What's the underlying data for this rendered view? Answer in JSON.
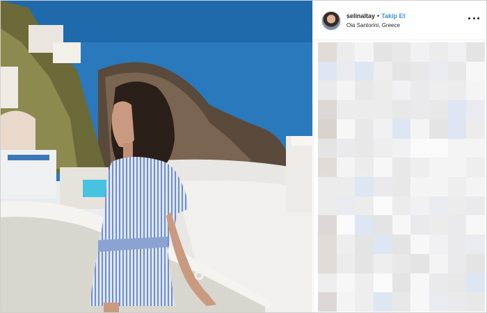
{
  "post": {
    "username": "selinaltay",
    "separator": "•",
    "follow_label": "Takip Et",
    "location": "Oia Santorini, Greece"
  },
  "icons": {
    "more": "more-options-icon",
    "avatar": "avatar"
  },
  "colors": {
    "follow": "#3897f0",
    "text": "#262626",
    "sea": "#2b7dc0"
  }
}
